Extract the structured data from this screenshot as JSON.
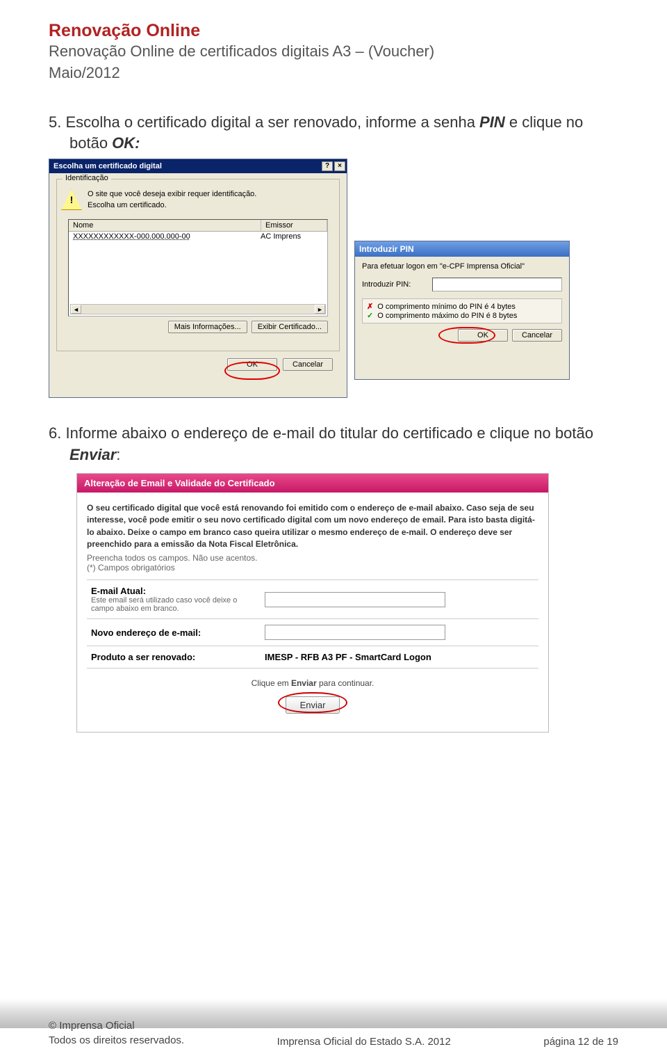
{
  "header": {
    "title": "Renovação Online",
    "subtitle": "Renovação Online de certificados digitais A3 – (Voucher)",
    "date": "Maio/2012"
  },
  "step5": {
    "num": "5.",
    "text_1": "Escolha o certificado digital a ser renovado, informe a senha ",
    "pin": "PIN",
    "text_2": " e clique no botão ",
    "ok": "OK:"
  },
  "dlg1": {
    "title": "Escolha um certificado digital",
    "help": "?",
    "close": "×",
    "group": "Identificação",
    "ident_l1": "O site que você deseja exibir requer identificação.",
    "ident_l2": "Escolha um certificado.",
    "col_nome": "Nome",
    "col_emissor": "Emissor",
    "row_nome": "XXXXXXXXXXXX-000.000.000-00",
    "row_emissor": "AC Imprens",
    "scroll_l": "◄",
    "scroll_r": "►",
    "btn_info": "Mais Informações...",
    "btn_exibir": "Exibir Certificado...",
    "btn_ok": "OK",
    "btn_cancel": "Cancelar"
  },
  "dlg2": {
    "title": "Introduzir PIN",
    "line1": "Para efetuar logon em \"e-CPF Imprensa Oficial\"",
    "label": "Introduzir PIN:",
    "rule1": "O comprimento mínimo do PIN é 4 bytes",
    "rule2": "O comprimento máximo do PIN é 8 bytes",
    "btn_ok": "OK",
    "btn_cancel": "Cancelar"
  },
  "step6": {
    "num": "6.",
    "text_1": "Informe abaixo o endereço de e-mail do titular do certificado e clique no botão ",
    "enviar": "Enviar",
    "text_2": ":"
  },
  "form": {
    "header": "Alteração de Email e Validade do Certificado",
    "desc": "O seu certificado digital que você está renovando foi emitido com o endereço de e-mail abaixo. Caso seja de seu interesse, você pode emitir o seu novo certificado digital com um novo endereço de email. Para isto basta digitá-lo abaixo. Deixe o campo em branco caso queira utilizar o mesmo endereço de e-mail. O endereço deve ser preenchido para a emissão da Nota Fiscal Eletrônica.",
    "note1": "Preencha todos os campos. Não use acentos.",
    "note2": "(*) Campos obrigatórios",
    "row1_label": "E-mail Atual:",
    "row1_sub": "Este email será utilizado caso você deixe o campo abaixo em branco.",
    "row2_label": "Novo endereço de e-mail:",
    "row3_label": "Produto a ser renovado:",
    "row3_value": "IMESP - RFB A3 PF - SmartCard Logon",
    "foot_pre": "Clique em ",
    "foot_b": "Enviar",
    "foot_post": " para continuar.",
    "btn_enviar": "Enviar"
  },
  "footer": {
    "l1": "© Imprensa Oficial",
    "l2": "Todos os direitos reservados.",
    "center": "Imprensa Oficial do Estado S.A. 2012",
    "right": "página  12  de 19"
  }
}
